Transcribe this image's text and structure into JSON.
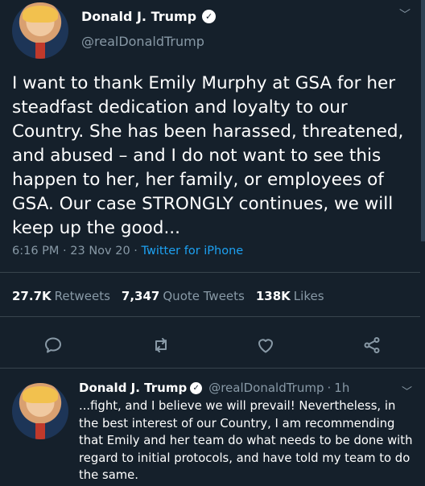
{
  "tweet": {
    "author_name": "Donald J. Trump",
    "verified_glyph": "✓",
    "handle": "@realDonaldTrump",
    "text": "I want to thank Emily Murphy at GSA for her steadfast dedication and loyalty to our Country. She has been harassed, threatened, and abused – and I do not want to see this happen to her, her family, or employees of GSA. Our case STRONGLY continues, we will keep up the good...",
    "time": "6:16 PM",
    "date": "23 Nov 20",
    "separator": "·",
    "source": "Twitter for iPhone",
    "caret_icon": "chevron-down-icon"
  },
  "stats": {
    "retweets_count": "27.7K",
    "retweets_label": "Retweets",
    "quotes_count": "7,347",
    "quotes_label": "Quote Tweets",
    "likes_count": "138K",
    "likes_label": "Likes"
  },
  "actions": [
    {
      "icon": "reply-icon"
    },
    {
      "icon": "retweet-icon"
    },
    {
      "icon": "like-icon"
    },
    {
      "icon": "share-icon"
    }
  ],
  "reply": {
    "author_name": "Donald J. Trump",
    "verified_glyph": "✓",
    "handle": "@realDonaldTrump",
    "dot": "·",
    "time_ago": "1h",
    "text": "...fight, and I believe we will prevail! Nevertheless, in the best interest of our Country, I am recommending that Emily and her team do what needs to be done with regard to initial protocols, and have told my team to do the same."
  },
  "colors": {
    "background": "#15202b",
    "secondary_text": "#8899a6",
    "link": "#1da1f2",
    "divider": "#38444d"
  }
}
